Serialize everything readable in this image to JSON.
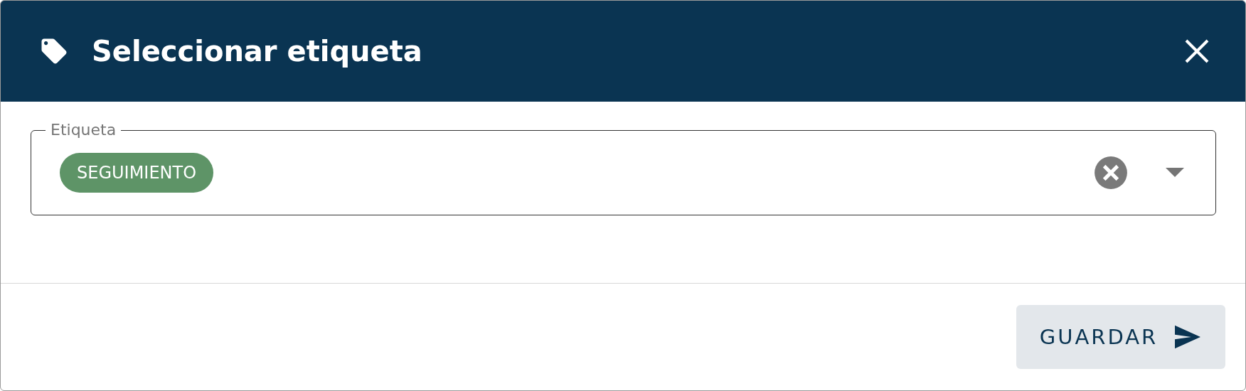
{
  "dialog": {
    "title": "Seleccionar etiqueta"
  },
  "field": {
    "label": "Etiqueta",
    "chips": [
      {
        "label": "SEGUIMIENTO",
        "color": "#5e9467"
      }
    ]
  },
  "buttons": [
    {
      "label": "GUARDAR"
    }
  ]
}
